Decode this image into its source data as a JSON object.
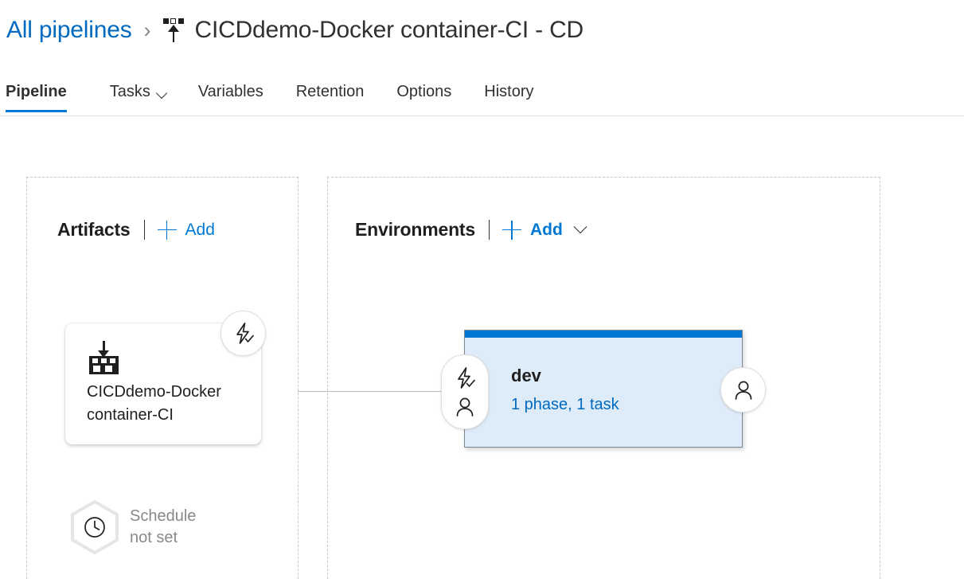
{
  "breadcrumb": {
    "parent_label": "All pipelines",
    "separator": "›",
    "icon": "release-pipeline-icon",
    "title": "CICDdemo-Docker container-CI - CD"
  },
  "tabs": [
    {
      "label": "Pipeline",
      "active": true,
      "has_chevron": false
    },
    {
      "label": "Tasks",
      "active": false,
      "has_chevron": true
    },
    {
      "label": "Variables",
      "active": false,
      "has_chevron": false
    },
    {
      "label": "Retention",
      "active": false,
      "has_chevron": false
    },
    {
      "label": "Options",
      "active": false,
      "has_chevron": false
    },
    {
      "label": "History",
      "active": false,
      "has_chevron": false
    }
  ],
  "artifacts": {
    "title": "Artifacts",
    "add_label": "Add",
    "card": {
      "name": "CICDdemo-Docker container-CI",
      "icon": "build-artifact-icon",
      "trigger_badge_icon": "continuous-deployment-trigger-icon"
    },
    "schedule": {
      "icon": "clock-icon",
      "text": "Schedule\nnot set"
    }
  },
  "environments": {
    "title": "Environments",
    "add_label": "Add",
    "cards": [
      {
        "name": "dev",
        "summary": "1 phase, 1 task",
        "pre_deployment_icons": [
          "continuous-deployment-trigger-icon",
          "pre-deployment-approval-icon"
        ],
        "post_deployment_icon": "post-deployment-approval-icon"
      }
    ]
  },
  "colors": {
    "accent_blue": "#0078d4",
    "link_blue": "#0069c0",
    "env_card_fill": "#deecf9",
    "env_card_border": "#7a8a94",
    "muted_gray": "#8a8886",
    "dashed_border": "#c8c8c8"
  }
}
